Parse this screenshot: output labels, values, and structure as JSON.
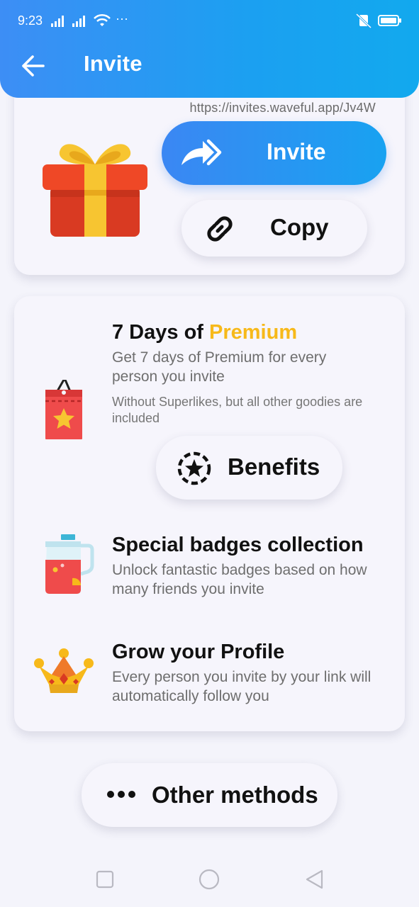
{
  "status_bar": {
    "time": "9:23",
    "dots": "···"
  },
  "header": {
    "title": "Invite"
  },
  "invite_card": {
    "url": "https://invites.waveful.app/Jv4W",
    "invite_label": "Invite",
    "copy_label": "Copy"
  },
  "benefits_card": {
    "premium": {
      "title_prefix": "7 Days of ",
      "title_highlight": "Premium",
      "description": "Get 7 days of Premium for every person you invite",
      "note": "Without Superlikes, but all other goodies are included",
      "benefits_label": "Benefits"
    },
    "badges": {
      "title": "Special badges collection",
      "description": "Unlock fantastic badges based on how many friends you invite"
    },
    "profile": {
      "title": "Grow your Profile",
      "description": "Every person you invite by your link will automatically follow you"
    }
  },
  "other_methods_label": "Other methods",
  "colors": {
    "header_gradient_start": "#3d8ef5",
    "header_gradient_end": "#12a9ee",
    "premium_highlight": "#f7b91a"
  }
}
